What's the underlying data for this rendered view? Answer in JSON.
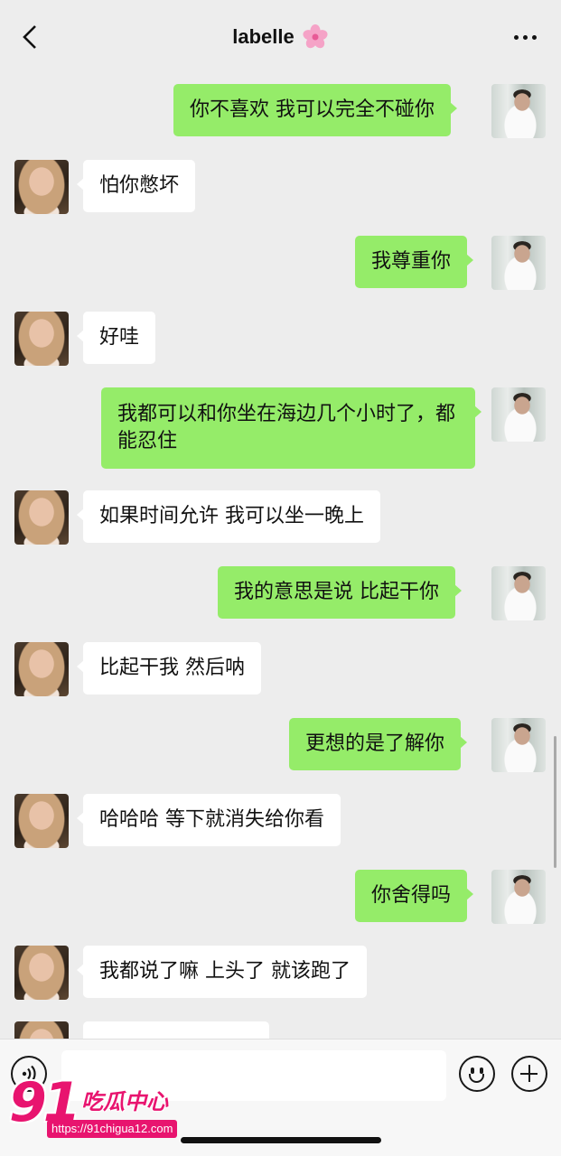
{
  "header": {
    "title": "labelle",
    "title_icon": "cherry-blossom-icon",
    "back_icon": "chevron-left-icon",
    "more_icon": "more-dots-icon"
  },
  "messages": [
    {
      "sender": "me",
      "text": "你不喜欢 我可以完全不碰你"
    },
    {
      "sender": "her",
      "text": "怕你憋坏"
    },
    {
      "sender": "me",
      "text": "我尊重你"
    },
    {
      "sender": "her",
      "text": "好哇"
    },
    {
      "sender": "me",
      "text": "我都可以和你坐在海边几个小时了，都能忍住"
    },
    {
      "sender": "her",
      "text": "如果时间允许 我可以坐一晚上"
    },
    {
      "sender": "me",
      "text": "我的意思是说 比起干你"
    },
    {
      "sender": "her",
      "text": "比起干我 然后呐"
    },
    {
      "sender": "me",
      "text": "更想的是了解你"
    },
    {
      "sender": "her",
      "text": "哈哈哈 等下就消失给你看"
    },
    {
      "sender": "me",
      "text": "你舍得吗"
    },
    {
      "sender": "her",
      "text": "我都说了嘛 上头了 就该跑了"
    }
  ],
  "input_bar": {
    "voice_icon": "voice-icon",
    "input_value": "",
    "emoji_icon": "emoji-icon",
    "plus_icon": "plus-icon"
  },
  "watermark": {
    "number": "91",
    "chinese": "吃瓜中心",
    "url": "https://91chigua12.com"
  },
  "colors": {
    "background": "#ededed",
    "my_bubble": "#95ec69",
    "her_bubble": "#ffffff",
    "watermark": "#e8146f"
  }
}
